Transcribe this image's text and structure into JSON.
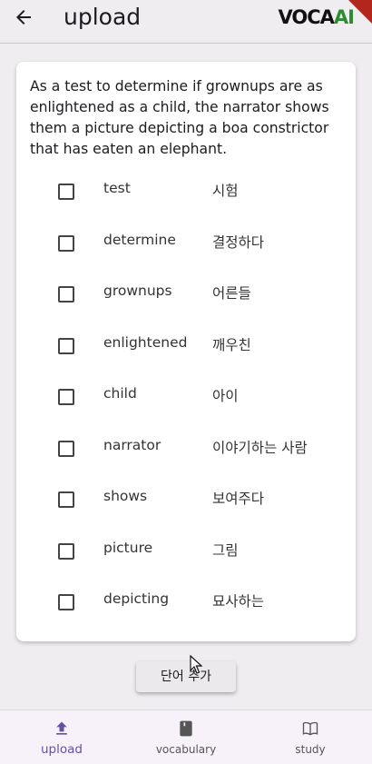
{
  "appbar": {
    "title": "upload",
    "logo_part1": "VOCA",
    "logo_part2": "AI"
  },
  "sentence": "As a test to determine if grownups are as enlightened as a child, the narrator shows them a picture depicting a boa constrictor that has eaten an elephant.",
  "words": [
    {
      "word": "test",
      "meaning": "시험"
    },
    {
      "word": "determine",
      "meaning": "결정하다"
    },
    {
      "word": "grownups",
      "meaning": "어른들"
    },
    {
      "word": "enlightened",
      "meaning": "깨우친"
    },
    {
      "word": "child",
      "meaning": "아이"
    },
    {
      "word": "narrator",
      "meaning": "이야기하는 사람"
    },
    {
      "word": "shows",
      "meaning": "보여주다"
    },
    {
      "word": "picture",
      "meaning": "그림"
    },
    {
      "word": "depicting",
      "meaning": "묘사하는"
    }
  ],
  "add_button_label": "단어 추가",
  "nav": [
    {
      "label": "upload",
      "icon": "upload-icon",
      "active": true
    },
    {
      "label": "vocabulary",
      "icon": "book-icon",
      "active": false
    },
    {
      "label": "study",
      "icon": "open-book-icon",
      "active": false
    }
  ],
  "colors": {
    "accent": "#6750a4",
    "logo_green": "#2e8b2e",
    "ribbon": "#b3261e"
  }
}
